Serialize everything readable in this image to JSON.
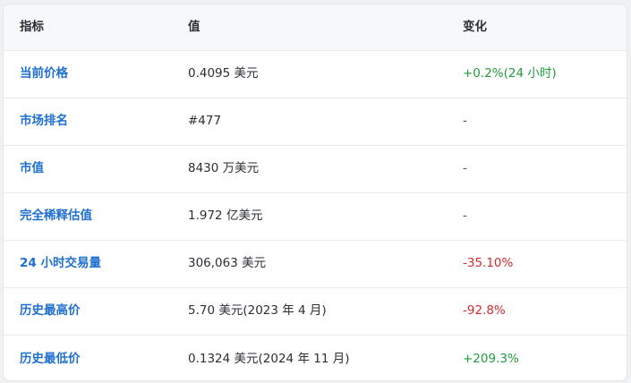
{
  "header": {
    "metric": "指标",
    "value": "值",
    "change": "变化"
  },
  "rows": [
    {
      "metric": "当前价格",
      "value": "0.4095 美元",
      "change": "+0.2%(24 小时)",
      "trend": "up"
    },
    {
      "metric": "市场排名",
      "value": "#477",
      "change": "-",
      "trend": "neutral"
    },
    {
      "metric": "市值",
      "value": "8430 万美元",
      "change": "-",
      "trend": "neutral"
    },
    {
      "metric": "完全稀释估值",
      "value": "1.972 亿美元",
      "change": "-",
      "trend": "neutral"
    },
    {
      "metric": "24 小时交易量",
      "value": "306,063 美元",
      "change": "-35.10%",
      "trend": "down"
    },
    {
      "metric": "历史最高价",
      "value": "5.70 美元(2023 年 4 月)",
      "change": "-92.8%",
      "trend": "down"
    },
    {
      "metric": "历史最低价",
      "value": "0.1324 美元(2024 年 11 月)",
      "change": "+209.3%",
      "trend": "up"
    }
  ],
  "colors": {
    "link_blue": "#1f6fd1",
    "positive_green": "#1f9d3a",
    "negative_red": "#d22b2b"
  }
}
